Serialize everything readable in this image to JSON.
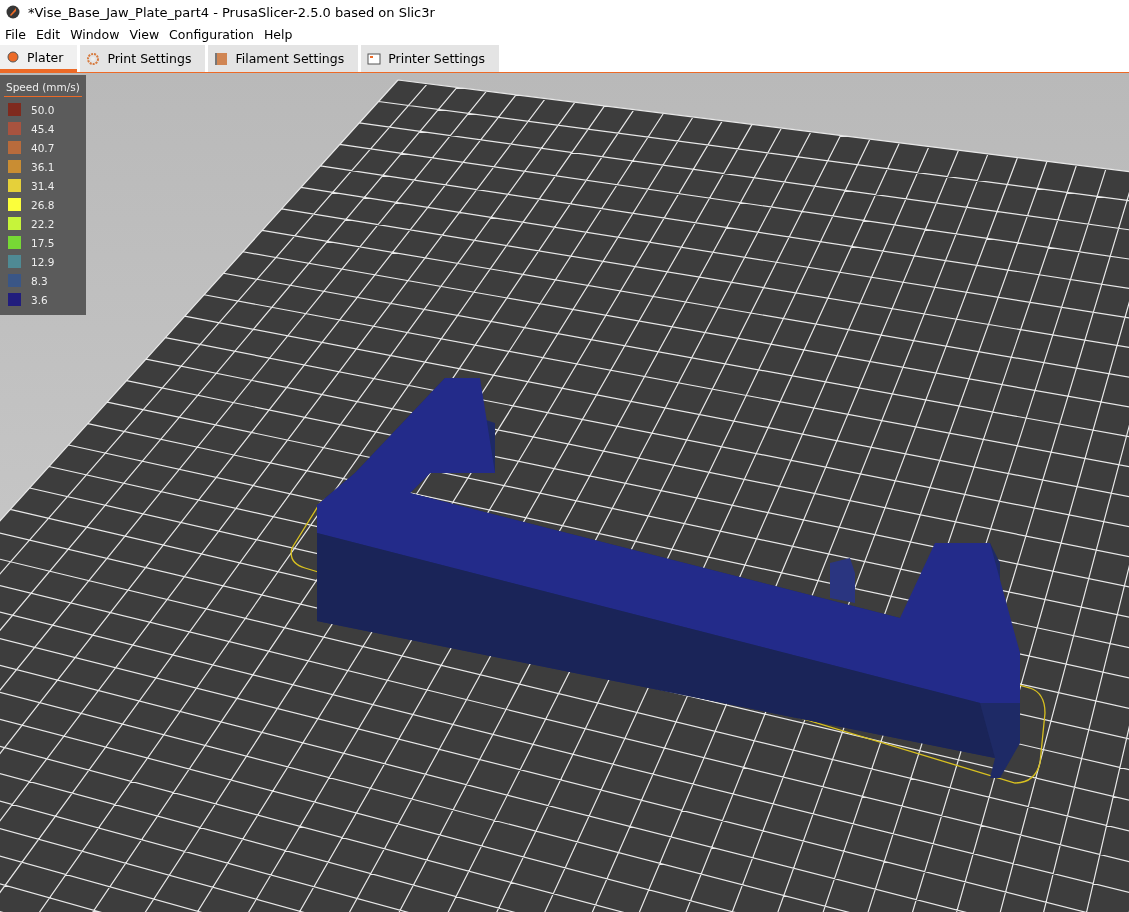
{
  "window": {
    "title": "*Vise_Base_Jaw_Plate_part4 - PrusaSlicer-2.5.0 based on Slic3r"
  },
  "menu": [
    "File",
    "Edit",
    "Window",
    "View",
    "Configuration",
    "Help"
  ],
  "tabs": [
    {
      "label": "Plater",
      "kind": "plater",
      "selected": true
    },
    {
      "label": "Print Settings",
      "kind": "print",
      "selected": false
    },
    {
      "label": "Filament Settings",
      "kind": "filament",
      "selected": false
    },
    {
      "label": "Printer Settings",
      "kind": "printer",
      "selected": false
    }
  ],
  "legend": {
    "title": "Speed (mm/s)",
    "items": [
      {
        "label": "50.0",
        "color": "#7f2a1e"
      },
      {
        "label": "45.4",
        "color": "#a8533f"
      },
      {
        "label": "40.7",
        "color": "#b86b3c"
      },
      {
        "label": "36.1",
        "color": "#c98d33"
      },
      {
        "label": "31.4",
        "color": "#e5d03a"
      },
      {
        "label": "26.8",
        "color": "#fbfe3b"
      },
      {
        "label": "22.2",
        "color": "#c6f43a"
      },
      {
        "label": "17.5",
        "color": "#77d835"
      },
      {
        "label": "12.9",
        "color": "#4f8a94"
      },
      {
        "label": "8.3",
        "color": "#3a5686"
      },
      {
        "label": "3.6",
        "color": "#211d7d"
      }
    ]
  }
}
